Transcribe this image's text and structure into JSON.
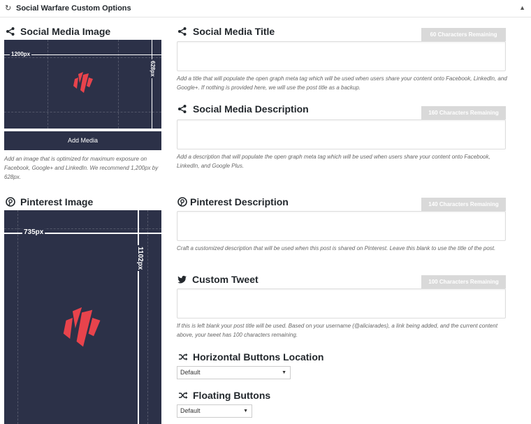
{
  "panel": {
    "title": "Social Warfare Custom Options"
  },
  "social_image": {
    "title": "Social Media Image",
    "width_label": "1200px",
    "height_label": "628px",
    "add_media_label": "Add Media",
    "help": "Add an image that is optimized for maximum exposure on Facebook, Google+ and LinkedIn. We recommend 1,200px by 628px."
  },
  "social_title": {
    "title": "Social Media Title",
    "counter": "60 Characters Remaining",
    "value": "",
    "help": "Add a title that will populate the open graph meta tag which will be used when users share your content onto Facebook, LinkedIn, and Google+. If nothing is provided here, we will use the post title as a backup."
  },
  "social_description": {
    "title": "Social Media Description",
    "counter": "160 Characters Remaining",
    "value": "",
    "help": "Add a description that will populate the open graph meta tag which will be used when users share your content onto Facebook, LinkedIn, and Google Plus."
  },
  "pinterest_image": {
    "title": "Pinterest Image",
    "width_label": "735px",
    "height_label": "1102px"
  },
  "pinterest_description": {
    "title": "Pinterest Description",
    "counter": "140 Characters Remaining",
    "value": "",
    "help": "Craft a customized description that will be used when this post is shared on Pinterest. Leave this blank to use the title of the post."
  },
  "custom_tweet": {
    "title": "Custom Tweet",
    "counter": "100 Characters Remaining",
    "value": "",
    "help": "If this is left blank your post title will be used. Based on your username (@aliciarades), a link being added, and the current content above, your tweet has 100 characters remaining."
  },
  "horizontal_location": {
    "title": "Horizontal Buttons Location",
    "selected": "Default"
  },
  "floating_buttons": {
    "title": "Floating Buttons",
    "selected": "Default"
  },
  "colors": {
    "image_bg": "#2c3148",
    "logo_red": "#e8434c",
    "counter_bg": "#d9d9d9"
  },
  "icons": {
    "panel": "share-alt-icon",
    "share": "share-icon",
    "pinterest": "pinterest-icon",
    "twitter": "twitter-icon",
    "shuffle": "shuffle-icon"
  }
}
